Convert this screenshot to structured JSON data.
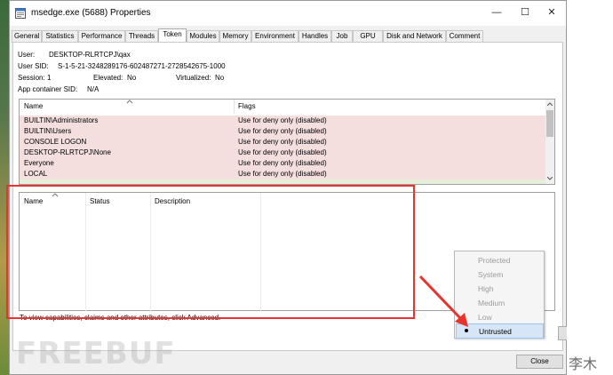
{
  "window": {
    "title": "msedge.exe (5688) Properties",
    "minimize_glyph": "—",
    "maximize_glyph": "☐",
    "close_glyph": "✕"
  },
  "tabs": [
    "General",
    "Statistics",
    "Performance",
    "Threads",
    "Token",
    "Modules",
    "Memory",
    "Environment",
    "Handles",
    "Job",
    "GPU",
    "Disk and Network",
    "Comment"
  ],
  "active_tab": "Token",
  "token_info": {
    "user_label": "User:",
    "user_value": "DESKTOP-RLRTCPJ\\qax",
    "sid_label": "User SID:",
    "sid_value": "S-1-5-21-3248289176-602487271-2728542675-1000",
    "session_label": "Session:",
    "session_value": "1",
    "elevated_label": "Elevated:",
    "elevated_value": "No",
    "virtualized_label": "Virtualized:",
    "virtualized_value": "No",
    "appcontainer_label": "App container SID:",
    "appcontainer_value": "N/A"
  },
  "groups_table": {
    "headers": {
      "name": "Name",
      "flags": "Flags"
    },
    "rows": [
      {
        "name": "BUILTIN\\Administrators",
        "flags": "Use for deny only (disabled)"
      },
      {
        "name": "BUILTIN\\Users",
        "flags": "Use for deny only (disabled)"
      },
      {
        "name": "CONSOLE LOGON",
        "flags": "Use for deny only (disabled)"
      },
      {
        "name": "DESKTOP-RLRTCPJ\\None",
        "flags": "Use for deny only (disabled)"
      },
      {
        "name": "Everyone",
        "flags": "Use for deny only (disabled)"
      },
      {
        "name": "LOCAL",
        "flags": "Use for deny only (disabled)"
      }
    ]
  },
  "privileges_table": {
    "headers": {
      "name": "Name",
      "status": "Status",
      "description": "Description"
    }
  },
  "hint_text": "To view capabilities, claims and other attributes, click Advanced.",
  "integrity_menu": {
    "items": [
      "Protected",
      "System",
      "High",
      "Medium",
      "Low",
      "Untrusted"
    ],
    "selected": "Untrusted"
  },
  "close_button": "Close",
  "watermark": "FREEBUF",
  "watermark_cn": "李木",
  "colors": {
    "annotation_red": "#e8332f",
    "row_highlight": "#f4dede",
    "menu_selected": "#d6e6f8"
  }
}
